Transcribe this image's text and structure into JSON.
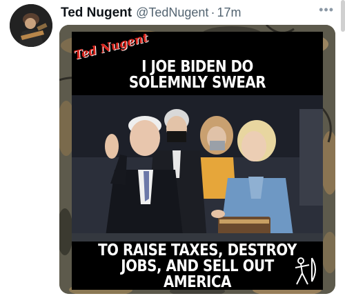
{
  "tweet": {
    "display_name": "Ted Nugent",
    "handle": "@TedNugent",
    "separator": "·",
    "time": "17m",
    "more": "•••"
  },
  "meme": {
    "logo": "Ted Nugent",
    "top_line_1": "I JOE BIDEN DO",
    "top_line_2": "SOLEMNLY SWEAR",
    "bottom_line_1": "TO RAISE TAXES, DESTROY",
    "bottom_line_2": "JOBS, AND SELL OUT AMERICA"
  },
  "colors": {
    "name": "#0f1419",
    "secondary": "#536471",
    "logo": "#d9241c"
  }
}
